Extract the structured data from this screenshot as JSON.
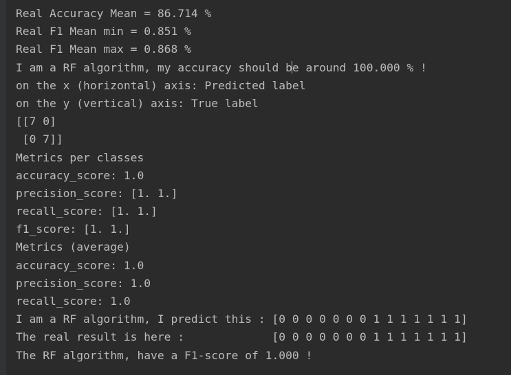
{
  "console": {
    "lines": [
      "Real Accuracy Mean = 86.714 %",
      "Real F1 Mean min = 0.851 %",
      "Real F1 Mean max = 0.868 %",
      "I am a RF algorithm, my accuracy should be around 100.000 % !",
      "on the x (horizontal) axis: Predicted label",
      "on the y (vertical) axis: True label",
      "[[7 0]",
      " [0 7]]",
      "Metrics per classes",
      "accuracy_score: 1.0",
      "precision_score: [1. 1.]",
      "recall_score: [1. 1.]",
      "f1_score: [1. 1.]",
      "Metrics (average)",
      "accuracy_score: 1.0",
      "precision_score: 1.0",
      "recall_score: 1.0",
      "I am a RF algorithm, I predict this : [0 0 0 0 0 0 0 1 1 1 1 1 1 1]",
      "The real result is here :             [0 0 0 0 0 0 0 1 1 1 1 1 1 1]",
      "The RF algorithm, have a F1-score of 1.000 !"
    ],
    "caret_line": 3,
    "caret_col": 41
  }
}
